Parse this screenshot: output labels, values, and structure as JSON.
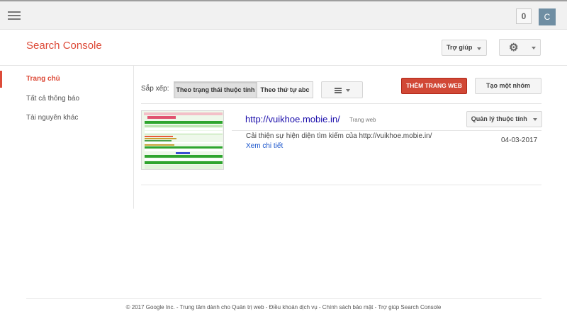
{
  "topbar": {
    "notification_count": "0",
    "avatar_letter": "C"
  },
  "brand": {
    "title": "Search Console"
  },
  "header": {
    "help_label": "Trợ giúp"
  },
  "sidebar": {
    "items": [
      {
        "label": "Trang chủ",
        "active": true
      },
      {
        "label": "Tất cả thông báo",
        "active": false
      },
      {
        "label": "Tài nguyên khác",
        "active": false
      }
    ]
  },
  "toolbar": {
    "sort_label": "Sắp xếp:",
    "sort_options": [
      "Theo trạng thái thuộc tính",
      "Theo thứ tự abc"
    ],
    "add_site_label": "THÊM TRANG WEB",
    "create_group_label": "Tạo một nhóm"
  },
  "sites": [
    {
      "url": "http://vuikhoe.mobie.in/",
      "type": "Trang web",
      "manage_label": "Quản lý thuộc tính",
      "message": "Cải thiện sự hiện diện tìm kiếm của http://vuikhoe.mobie.in/",
      "message_date": "04-03-2017",
      "details_link": "Xem chi tiết"
    }
  ],
  "footer": {
    "text": "© 2017 Google Inc. - Trung tâm dành cho Quản trị web - Điều khoản dịch vụ - Chính sách bảo mật - Trợ giúp Search Console"
  },
  "colors": {
    "brand_red": "#dd4b39",
    "link_blue": "#1a0dab",
    "primary_button": "#d14836"
  }
}
